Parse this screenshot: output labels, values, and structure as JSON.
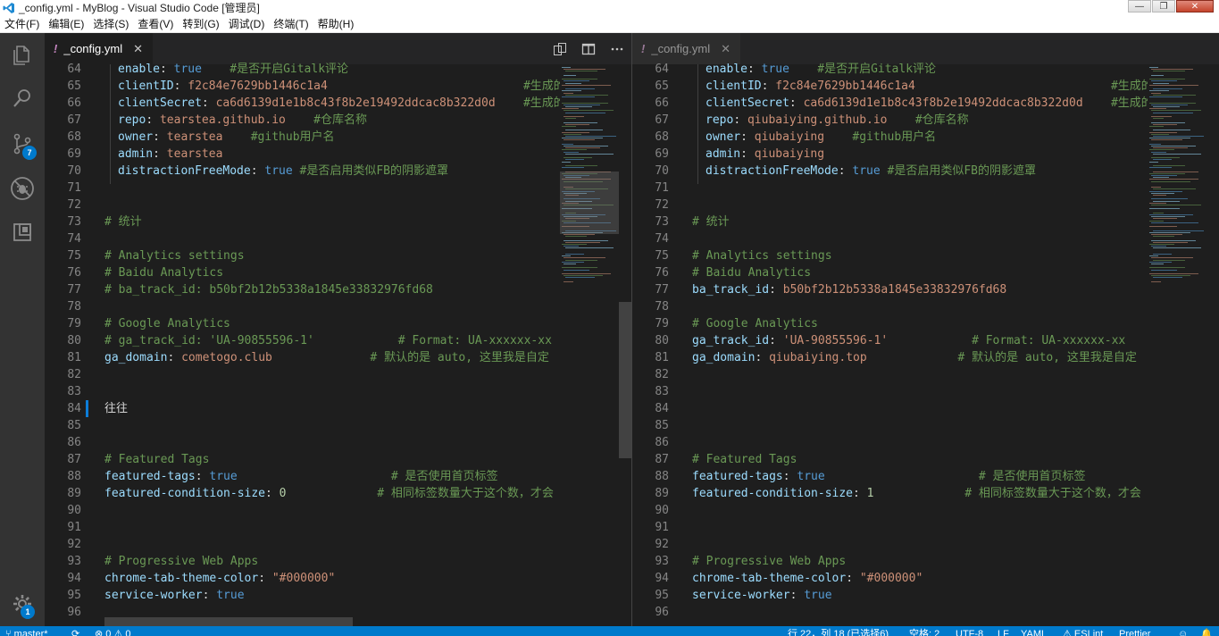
{
  "window": {
    "title": "_config.yml - MyBlog - Visual Studio Code [管理员]",
    "minimize_glyph": "—",
    "maximize_glyph": "❐",
    "close_glyph": "✕"
  },
  "menu": [
    "文件(F)",
    "编辑(E)",
    "选择(S)",
    "查看(V)",
    "转到(G)",
    "调试(D)",
    "终端(T)",
    "帮助(H)"
  ],
  "activity": {
    "items": [
      "explorer-icon",
      "search-icon",
      "source-control-icon",
      "extensions-debug-icon",
      "remote-explorer-icon"
    ],
    "scm_badge": "7",
    "settings_badge": "1"
  },
  "editors": {
    "left": {
      "tab": {
        "indicator": "!",
        "label": "_config.yml",
        "close": "✕"
      },
      "actions": [
        "open-changes-icon",
        "split-editor-icon",
        "more-actions-icon"
      ],
      "lines": [
        {
          "n": "64",
          "parts": [
            [
              "prop",
              "enable"
            ],
            [
              "p",
              ": "
            ],
            [
              "b",
              "true"
            ],
            [
              "c",
              "    #是否开启Gitalk评论"
            ]
          ]
        },
        {
          "n": "65",
          "parts": [
            [
              "prop",
              "clientID"
            ],
            [
              "p",
              ": "
            ],
            [
              "v",
              "f2c84e7629bb1446c1a4"
            ],
            [
              "c",
              "                            #生成的"
            ]
          ]
        },
        {
          "n": "66",
          "parts": [
            [
              "prop",
              "clientSecret"
            ],
            [
              "p",
              ": "
            ],
            [
              "v",
              "ca6d6139d1e1b8c43f8b2e19492ddcac8b322d0d"
            ],
            [
              "c",
              "    #生成的"
            ]
          ]
        },
        {
          "n": "67",
          "parts": [
            [
              "prop",
              "repo"
            ],
            [
              "p",
              ": "
            ],
            [
              "v",
              "tearstea.github.io"
            ],
            [
              "c",
              "    #仓库名称"
            ]
          ]
        },
        {
          "n": "68",
          "parts": [
            [
              "prop",
              "owner"
            ],
            [
              "p",
              ": "
            ],
            [
              "v",
              "tearstea"
            ],
            [
              "c",
              "    #github用户名"
            ]
          ]
        },
        {
          "n": "69",
          "parts": [
            [
              "prop",
              "admin"
            ],
            [
              "p",
              ": "
            ],
            [
              "v",
              "tearstea"
            ]
          ]
        },
        {
          "n": "70",
          "parts": [
            [
              "prop",
              "distractionFreeMode"
            ],
            [
              "p",
              ": "
            ],
            [
              "b",
              "true"
            ],
            [
              "c",
              " #是否启用类似FB的阴影遮罩"
            ]
          ]
        },
        {
          "n": "71",
          "parts": []
        },
        {
          "n": "72",
          "parts": []
        },
        {
          "n": "73",
          "parts": [
            [
              "c",
              "# 统计"
            ]
          ],
          "outdent": true
        },
        {
          "n": "74",
          "parts": []
        },
        {
          "n": "75",
          "parts": [
            [
              "c",
              "# Analytics settings"
            ]
          ],
          "outdent": true
        },
        {
          "n": "76",
          "parts": [
            [
              "c",
              "# Baidu Analytics"
            ]
          ],
          "outdent": true
        },
        {
          "n": "77",
          "parts": [
            [
              "c",
              "# ba_track_id: b50bf2b12b5338a1845e33832976fd68"
            ]
          ],
          "outdent": true
        },
        {
          "n": "78",
          "parts": []
        },
        {
          "n": "79",
          "parts": [
            [
              "c",
              "# Google Analytics"
            ]
          ],
          "outdent": true
        },
        {
          "n": "80",
          "parts": [
            [
              "c",
              "# ga_track_id: 'UA-90855596-1'            # Format: UA-xxxxxx-xx"
            ]
          ],
          "outdent": true
        },
        {
          "n": "81",
          "parts": [
            [
              "prop",
              "ga_domain"
            ],
            [
              "p",
              ": "
            ],
            [
              "v",
              "cometogo.club"
            ],
            [
              "c",
              "              # 默认的是 auto, 这里我是自定"
            ]
          ],
          "outdent": true
        },
        {
          "n": "82",
          "parts": []
        },
        {
          "n": "83",
          "parts": []
        },
        {
          "n": "84",
          "parts": [
            [
              "plain",
              "往往"
            ]
          ],
          "outdent": true,
          "cursor": true
        },
        {
          "n": "85",
          "parts": []
        },
        {
          "n": "86",
          "parts": []
        },
        {
          "n": "87",
          "parts": [
            [
              "c",
              "# Featured Tags"
            ]
          ],
          "outdent": true
        },
        {
          "n": "88",
          "parts": [
            [
              "prop",
              "featured-tags"
            ],
            [
              "p",
              ": "
            ],
            [
              "b",
              "true"
            ],
            [
              "c",
              "                      # 是否使用首页标签"
            ]
          ],
          "outdent": true
        },
        {
          "n": "89",
          "parts": [
            [
              "prop",
              "featured-condition-size"
            ],
            [
              "p",
              ": "
            ],
            [
              "n",
              "0"
            ],
            [
              "c",
              "             # 相同标签数量大于这个数，才会"
            ]
          ],
          "outdent": true
        },
        {
          "n": "90",
          "parts": []
        },
        {
          "n": "91",
          "parts": []
        },
        {
          "n": "92",
          "parts": []
        },
        {
          "n": "93",
          "parts": [
            [
              "c",
              "# Progressive Web Apps"
            ]
          ],
          "outdent": true
        },
        {
          "n": "94",
          "parts": [
            [
              "prop",
              "chrome-tab-theme-color"
            ],
            [
              "p",
              ": "
            ],
            [
              "v",
              "\"#000000\""
            ]
          ],
          "outdent": true
        },
        {
          "n": "95",
          "parts": [
            [
              "prop",
              "service-worker"
            ],
            [
              "p",
              ": "
            ],
            [
              "b",
              "true"
            ]
          ],
          "outdent": true
        },
        {
          "n": "96",
          "parts": []
        }
      ]
    },
    "right": {
      "tab": {
        "indicator": "!",
        "label": "_config.yml",
        "close": "✕"
      },
      "lines": [
        {
          "n": "64",
          "parts": [
            [
              "prop",
              "enable"
            ],
            [
              "p",
              ": "
            ],
            [
              "b",
              "true"
            ],
            [
              "c",
              "    #是否开启Gitalk评论"
            ]
          ]
        },
        {
          "n": "65",
          "parts": [
            [
              "prop",
              "clientID"
            ],
            [
              "p",
              ": "
            ],
            [
              "v",
              "f2c84e7629bb1446c1a4"
            ],
            [
              "c",
              "                            #生成的"
            ]
          ]
        },
        {
          "n": "66",
          "parts": [
            [
              "prop",
              "clientSecret"
            ],
            [
              "p",
              ": "
            ],
            [
              "v",
              "ca6d6139d1e1b8c43f8b2e19492ddcac8b322d0d"
            ],
            [
              "c",
              "    #生成的"
            ]
          ]
        },
        {
          "n": "67",
          "parts": [
            [
              "prop",
              "repo"
            ],
            [
              "p",
              ": "
            ],
            [
              "v",
              "qiubaiying.github.io"
            ],
            [
              "c",
              "    #仓库名称"
            ]
          ]
        },
        {
          "n": "68",
          "parts": [
            [
              "prop",
              "owner"
            ],
            [
              "p",
              ": "
            ],
            [
              "v",
              "qiubaiying"
            ],
            [
              "c",
              "    #github用户名"
            ]
          ]
        },
        {
          "n": "69",
          "parts": [
            [
              "prop",
              "admin"
            ],
            [
              "p",
              ": "
            ],
            [
              "v",
              "qiubaiying"
            ]
          ]
        },
        {
          "n": "70",
          "parts": [
            [
              "prop",
              "distractionFreeMode"
            ],
            [
              "p",
              ": "
            ],
            [
              "b",
              "true"
            ],
            [
              "c",
              " #是否启用类似FB的阴影遮罩"
            ]
          ]
        },
        {
          "n": "71",
          "parts": []
        },
        {
          "n": "72",
          "parts": []
        },
        {
          "n": "73",
          "parts": [
            [
              "c",
              "# 统计"
            ]
          ],
          "outdent": true
        },
        {
          "n": "74",
          "parts": []
        },
        {
          "n": "75",
          "parts": [
            [
              "c",
              "# Analytics settings"
            ]
          ],
          "outdent": true
        },
        {
          "n": "76",
          "parts": [
            [
              "c",
              "# Baidu Analytics"
            ]
          ],
          "outdent": true
        },
        {
          "n": "77",
          "parts": [
            [
              "prop",
              "ba_track_id"
            ],
            [
              "p",
              ": "
            ],
            [
              "v",
              "b50bf2b12b5338a1845e33832976fd68"
            ]
          ],
          "outdent": true
        },
        {
          "n": "78",
          "parts": []
        },
        {
          "n": "79",
          "parts": [
            [
              "c",
              "# Google Analytics"
            ]
          ],
          "outdent": true
        },
        {
          "n": "80",
          "parts": [
            [
              "prop",
              "ga_track_id"
            ],
            [
              "p",
              ": "
            ],
            [
              "v",
              "'UA-90855596-1'"
            ],
            [
              "c",
              "            # Format: UA-xxxxxx-xx"
            ]
          ],
          "outdent": true
        },
        {
          "n": "81",
          "parts": [
            [
              "prop",
              "ga_domain"
            ],
            [
              "p",
              ": "
            ],
            [
              "v",
              "qiubaiying.top"
            ],
            [
              "c",
              "             # 默认的是 auto, 这里我是自定"
            ]
          ],
          "outdent": true
        },
        {
          "n": "82",
          "parts": []
        },
        {
          "n": "83",
          "parts": []
        },
        {
          "n": "84",
          "parts": []
        },
        {
          "n": "85",
          "parts": []
        },
        {
          "n": "86",
          "parts": []
        },
        {
          "n": "87",
          "parts": [
            [
              "c",
              "# Featured Tags"
            ]
          ],
          "outdent": true
        },
        {
          "n": "88",
          "parts": [
            [
              "prop",
              "featured-tags"
            ],
            [
              "p",
              ": "
            ],
            [
              "b",
              "true"
            ],
            [
              "c",
              "                      # 是否使用首页标签"
            ]
          ],
          "outdent": true
        },
        {
          "n": "89",
          "parts": [
            [
              "prop",
              "featured-condition-size"
            ],
            [
              "p",
              ": "
            ],
            [
              "n",
              "1"
            ],
            [
              "c",
              "             # 相同标签数量大于这个数，才会"
            ]
          ],
          "outdent": true
        },
        {
          "n": "90",
          "parts": []
        },
        {
          "n": "91",
          "parts": []
        },
        {
          "n": "92",
          "parts": []
        },
        {
          "n": "93",
          "parts": [
            [
              "c",
              "# Progressive Web Apps"
            ]
          ],
          "outdent": true
        },
        {
          "n": "94",
          "parts": [
            [
              "prop",
              "chrome-tab-theme-color"
            ],
            [
              "p",
              ": "
            ],
            [
              "v",
              "\"#000000\""
            ]
          ],
          "outdent": true
        },
        {
          "n": "95",
          "parts": [
            [
              "prop",
              "service-worker"
            ],
            [
              "p",
              ": "
            ],
            [
              "b",
              "true"
            ]
          ],
          "outdent": true
        },
        {
          "n": "96",
          "parts": []
        }
      ]
    }
  },
  "statusbar": {
    "branch": "master*",
    "sync_glyph": "⟳",
    "problems": "⊗ 0 ⚠ 0",
    "position": "行 22，列 18 (已选择6)",
    "spaces": "空格: 2",
    "encoding": "UTF-8",
    "eol": "LF",
    "language": "YAML",
    "eslint": "ESLint",
    "prettier": "Prettier"
  },
  "colors": {
    "accent": "#007acc",
    "editor_bg": "#1e1e1e",
    "activity_bg": "#333333",
    "keyword": "#569cd6",
    "property": "#9cdcfe",
    "string": "#ce9178",
    "comment": "#6a9955",
    "number": "#b5cea8"
  }
}
